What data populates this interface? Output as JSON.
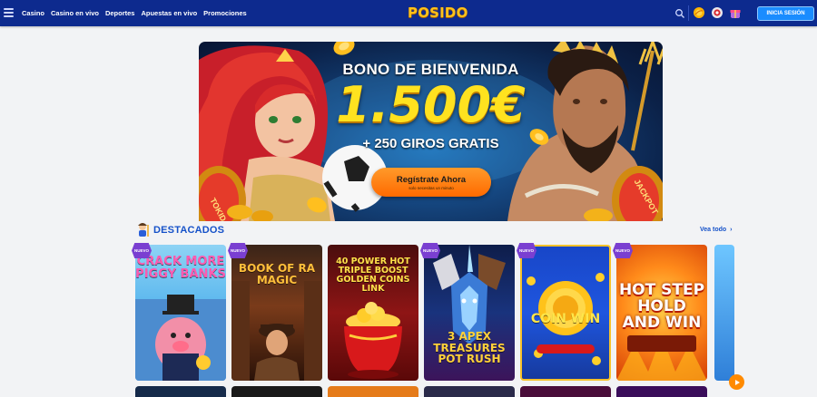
{
  "header": {
    "nav": [
      "Casino",
      "Casino en vivo",
      "Deportes",
      "Apuestas en vivo",
      "Promociones"
    ],
    "logo": "POSIDO",
    "login_label": "INICIA SESIÓN"
  },
  "banner": {
    "title": "BONO DE BIENVENIDA",
    "amount": "1.500€",
    "spins": "+ 250 GIROS GRATIS",
    "cta_label": "Regístrate Ahora",
    "cta_sub": "solo necesitas un minuto",
    "left_reel_text": "TOKIDAL",
    "right_reel_text": "JACKPOT"
  },
  "section": {
    "title": "DESTACADOS",
    "view_all": "Vea todo",
    "games": [
      {
        "name": "CRACK MORE PIGGY BANKS",
        "badge": "NUEVO"
      },
      {
        "name": "BOOK OF RA MAGIC",
        "badge": "NUEVO"
      },
      {
        "name": "40 POWER HOT TRIPLE BOOST GOLDEN COINS LINK",
        "badge": ""
      },
      {
        "name": "3 APEX TREASURES POT RUSH",
        "badge": "NUEVO"
      },
      {
        "name": "COIN WIN",
        "badge": "NUEVO"
      },
      {
        "name": "HOT STEP HOLD AND WIN",
        "badge": "NUEVO"
      }
    ]
  },
  "colors": {
    "header_bg": "#0d2a8e",
    "accent_blue": "#1652c9",
    "login_button": "#1a8cff",
    "cta_orange": "#ff7a00",
    "badge_purple": "#7a3fd1"
  },
  "icons": [
    "menu-icon",
    "search-icon",
    "coin-icon",
    "chip-icon",
    "gift-icon",
    "chevron-right-icon",
    "play-icon"
  ]
}
